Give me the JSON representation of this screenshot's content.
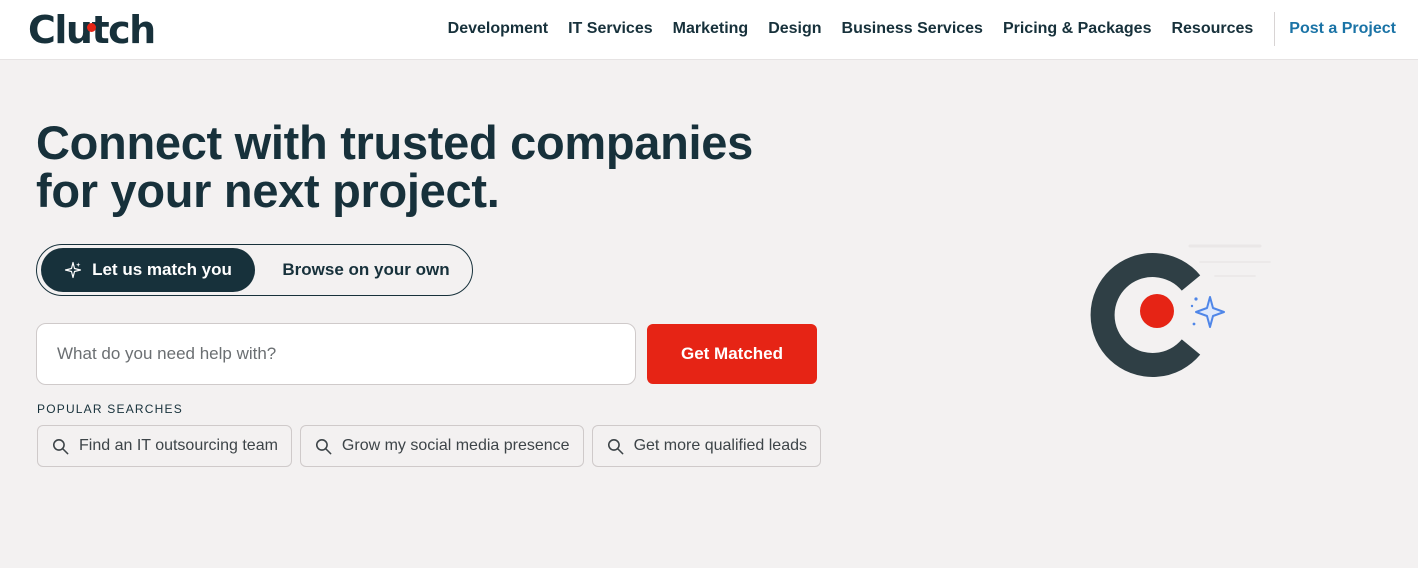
{
  "header": {
    "logo": "Clutch",
    "nav": [
      {
        "label": "Development"
      },
      {
        "label": "IT Services"
      },
      {
        "label": "Marketing"
      },
      {
        "label": "Design"
      },
      {
        "label": "Business Services"
      },
      {
        "label": "Pricing & Packages"
      },
      {
        "label": "Resources"
      }
    ],
    "cta": "Post a Project"
  },
  "hero": {
    "title_line1": "Connect with trusted companies",
    "title_line2": "for your next project."
  },
  "toggle": {
    "active_label": "Let us match you",
    "active_icon": "sparkle-icon",
    "other_label": "Browse on your own"
  },
  "search": {
    "placeholder": "What do you need help with?",
    "value": "",
    "button_label": "Get Matched"
  },
  "popular": {
    "label": "POPULAR SEARCHES",
    "items": [
      {
        "label": "Find an IT outsourcing team",
        "icon": "search-icon"
      },
      {
        "label": "Grow my social media presence",
        "icon": "search-icon"
      },
      {
        "label": "Get more qualified leads",
        "icon": "search-icon"
      }
    ]
  },
  "colors": {
    "brand_dark": "#17313b",
    "accent_red": "#e62415",
    "link_blue": "#1a73a6",
    "sparkle_blue": "#4f86e8"
  }
}
